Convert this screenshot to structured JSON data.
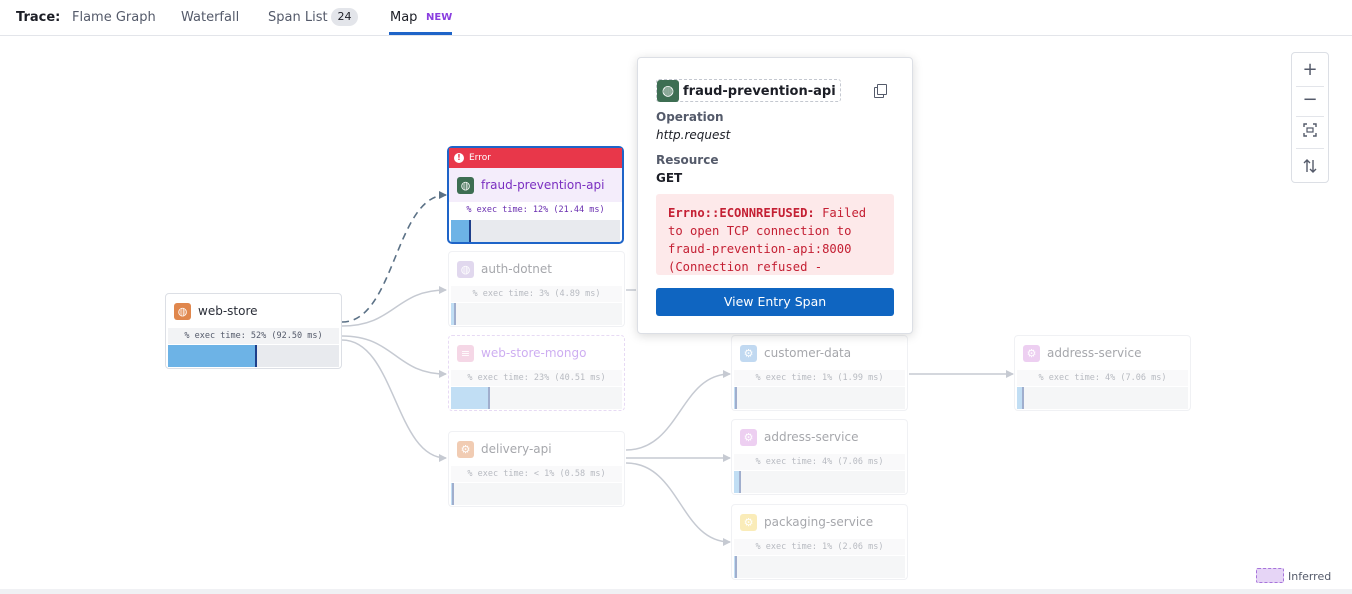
{
  "tabbar": {
    "trace_label": "Trace:",
    "tabs": [
      "Flame Graph",
      "Waterfall",
      "Span List",
      "Map"
    ],
    "span_count": "24",
    "new_badge": "NEW"
  },
  "nodes": {
    "web_store": {
      "name": "web-store",
      "exec": "% exec time: 52% (92.50 ms)",
      "fill": 0.52
    },
    "fraud": {
      "error_label": "Error",
      "name": "fraud-prevention-api",
      "exec": "% exec time: 12% (21.44 ms)",
      "fill": 0.12
    },
    "auth": {
      "name": "auth-dotnet",
      "exec": "% exec time: 3% (4.89 ms)",
      "fill": 0.03
    },
    "mongo": {
      "name": "web-store-mongo",
      "exec": "% exec time: 23% (40.51 ms)",
      "fill": 0.23
    },
    "delivery": {
      "name": "delivery-api",
      "exec": "% exec time: < 1% (0.58 ms)",
      "fill": 0.005
    },
    "customer": {
      "name": "customer-data",
      "exec": "% exec time: 1% (1.99 ms)",
      "fill": 0.01
    },
    "address_mid": {
      "name": "address-service",
      "exec": "% exec time: 4% (7.06 ms)",
      "fill": 0.04
    },
    "packaging": {
      "name": "packaging-service",
      "exec": "% exec time: 1% (2.06 ms)",
      "fill": 0.01
    },
    "address_right": {
      "name": "address-service",
      "exec": "% exec time: 4% (7.06 ms)",
      "fill": 0.04
    }
  },
  "popover": {
    "title": "fraud-prevention-api",
    "operation_label": "Operation",
    "operation_value": "http.request",
    "resource_label": "Resource",
    "resource_value": "GET",
    "error_type": "Errno::ECONNREFUSED:",
    "error_message": "Failed to open TCP connection to fraud-prevention-api:8000 (Connection refused -",
    "button": "View Entry Span"
  },
  "zoom": {
    "in": "+",
    "out": "−"
  },
  "legend": {
    "inferred": "Inferred"
  }
}
